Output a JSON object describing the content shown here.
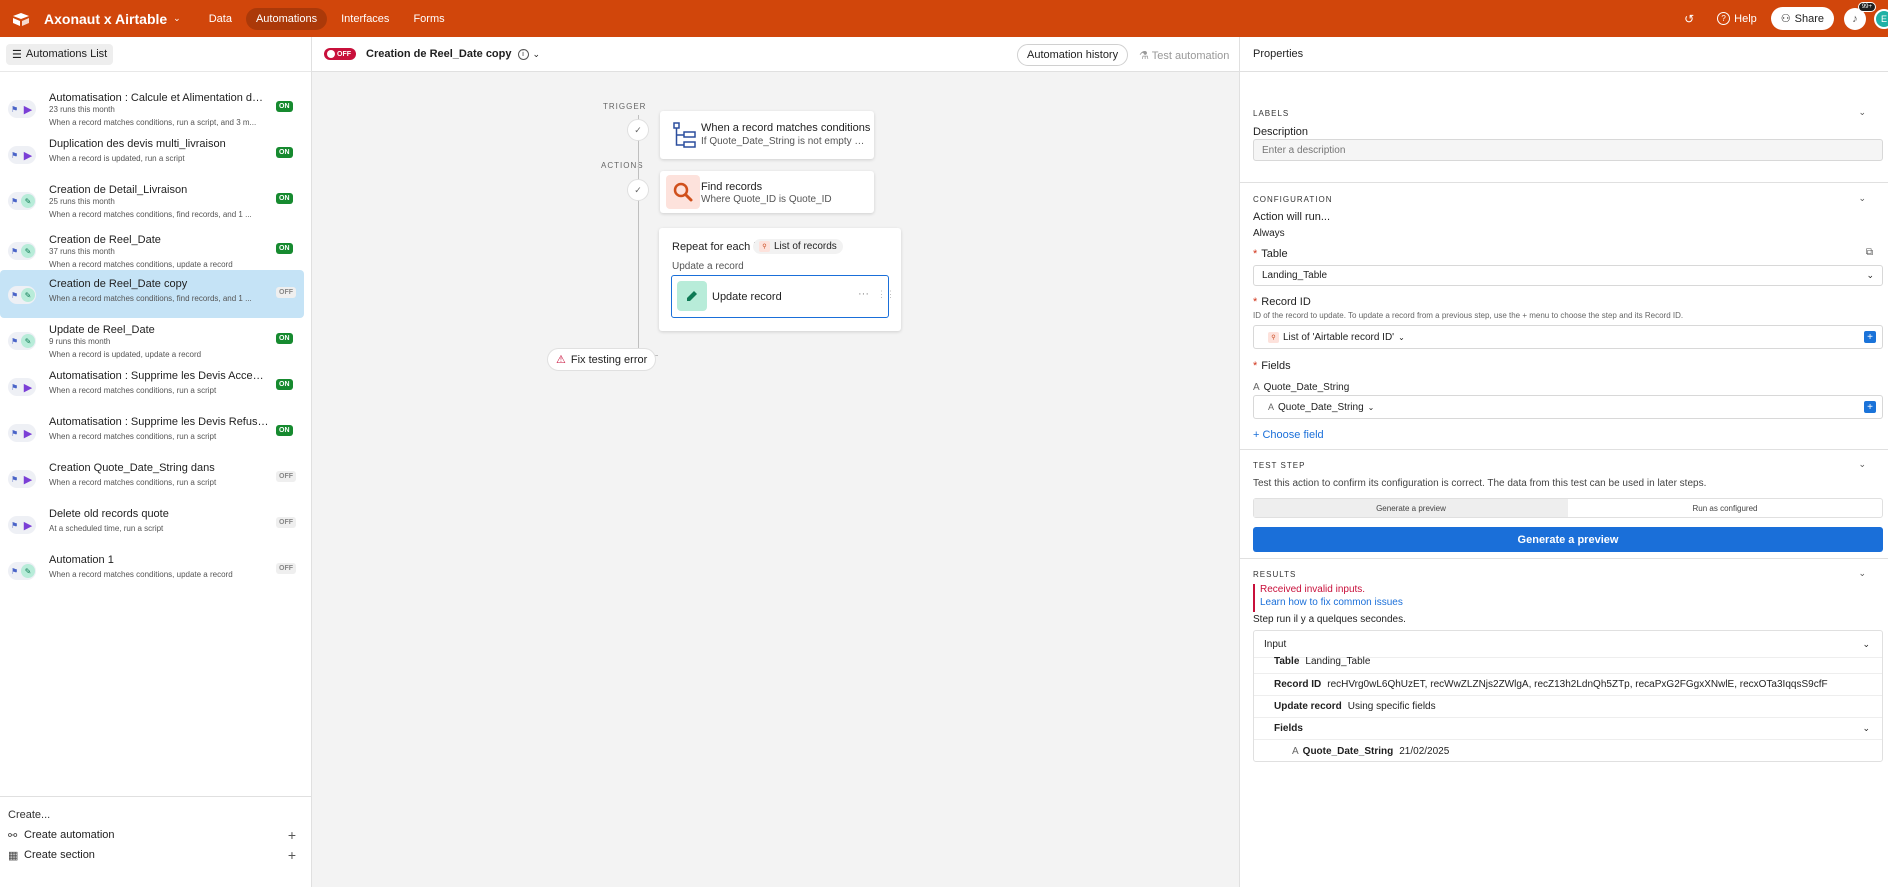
{
  "topbar": {
    "base_name": "Axonaut x Airtable",
    "nav": [
      "Data",
      "Automations",
      "Interfaces",
      "Forms"
    ],
    "active_nav": "Automations",
    "help": "Help",
    "share": "Share",
    "notif_count": "99+",
    "avatar_initial": "E",
    "brand_color": "#d1460b"
  },
  "sidebar": {
    "list_button": "Automations List",
    "items": [
      {
        "title": "Automatisation : Calcule et Alimentation des t...",
        "runs": "23 runs this month",
        "desc": "When a record matches conditions, run a script, and 3 m...",
        "status": "ON",
        "icon": "play-icon"
      },
      {
        "title": "Duplication des devis multi_livraison",
        "runs": "",
        "desc": "When a record is updated, run a script",
        "status": "ON",
        "icon": "play-icon"
      },
      {
        "title": "Creation de Detail_Livraison",
        "runs": "25 runs this month",
        "desc": "When a record matches conditions, find records, and 1 ...",
        "status": "ON",
        "icon": "pencil-icon"
      },
      {
        "title": "Creation de Reel_Date",
        "runs": "37 runs this month",
        "desc": "When a record matches conditions, update a record",
        "status": "ON",
        "icon": "pencil-icon"
      },
      {
        "title": "Creation de Reel_Date copy",
        "runs": "",
        "desc": "When a record matches conditions, find records, and 1 ...",
        "status": "OFF",
        "icon": "pencil-icon"
      },
      {
        "title": "Update de Reel_Date",
        "runs": "9 runs this month",
        "desc": "When a record is updated, update a record",
        "status": "ON",
        "icon": "pencil-icon"
      },
      {
        "title": "Automatisation : Supprime les Devis Accepted...",
        "runs": "",
        "desc": "When a record matches conditions, run a script",
        "status": "ON",
        "icon": "play-icon"
      },
      {
        "title": "Automatisation : Supprime les Devis Refused",
        "runs": "",
        "desc": "When a record matches conditions, run a script",
        "status": "ON",
        "icon": "play-icon"
      },
      {
        "title": "Creation Quote_Date_String dans",
        "runs": "",
        "desc": "When a record matches conditions, run a script",
        "status": "OFF",
        "icon": "play-icon"
      },
      {
        "title": "Delete old records quote",
        "runs": "",
        "desc": "At a scheduled time, run a script",
        "status": "OFF",
        "icon": "play-icon"
      },
      {
        "title": "Automation 1",
        "runs": "",
        "desc": "When a record matches conditions, update a record",
        "status": "OFF",
        "icon": "pencil-icon"
      }
    ],
    "create_label": "Create...",
    "create_automation": "Create automation",
    "create_section": "Create section"
  },
  "canvas": {
    "toggle": "OFF",
    "automation_name": "Creation de Reel_Date copy",
    "history_button": "Automation history",
    "test_button": "Test automation",
    "trigger_label": "TRIGGER",
    "actions_label": "ACTIONS",
    "trigger": {
      "title": "When a record matches conditions",
      "sub": "If Quote_Date_String is not empty and Axon..."
    },
    "find": {
      "title": "Find records",
      "sub": "Where Quote_ID is Quote_ID"
    },
    "repeat": {
      "title": "Repeat for each in",
      "pill": "List of records",
      "sub": "Update a record"
    },
    "update": {
      "title": "Update record"
    },
    "fix_button": "Fix testing error"
  },
  "properties": {
    "title": "Properties",
    "labels_section": "LABELS",
    "description_label": "Description",
    "description_placeholder": "Enter a description",
    "config_section": "CONFIGURATION",
    "action_will_run": "Action will run...",
    "always": "Always",
    "table_label": "Table",
    "table_value": "Landing_Table",
    "record_id_label": "Record ID",
    "record_id_help": "ID of the record to update. To update a record from a previous step, use the + menu to choose the step and its Record ID.",
    "record_id_value": "List of 'Airtable record ID'",
    "fields_label": "Fields",
    "field_name": "Quote_Date_String",
    "field_value": "Quote_Date_String",
    "choose_field": "Choose field",
    "test_section": "TEST STEP",
    "test_desc": "Test this action to confirm its configuration is correct. The data from this test can be used in later steps.",
    "seg_generate": "Generate a preview",
    "seg_run": "Run as configured",
    "generate_button": "Generate a preview",
    "results_section": "RESULTS",
    "error_text": "Received invalid inputs.",
    "error_link": "Learn how to fix common issues",
    "step_run": "Step run il y a quelques secondes.",
    "input_label": "Input",
    "rows": {
      "table_key": "Table",
      "table_val": "Landing_Table",
      "record_key": "Record ID",
      "record_val": "recHVrg0wL6QhUzET, recWwZLZNjs2ZWlgA, recZ13h2LdnQh5ZTp, recaPxG2FGgxXNwlE, recxOTa3IqqsS9cfF",
      "update_key": "Update record",
      "update_val": "Using specific fields",
      "fields_key": "Fields",
      "qds_key": "Quote_Date_String",
      "qds_val": "21/02/2025"
    }
  }
}
